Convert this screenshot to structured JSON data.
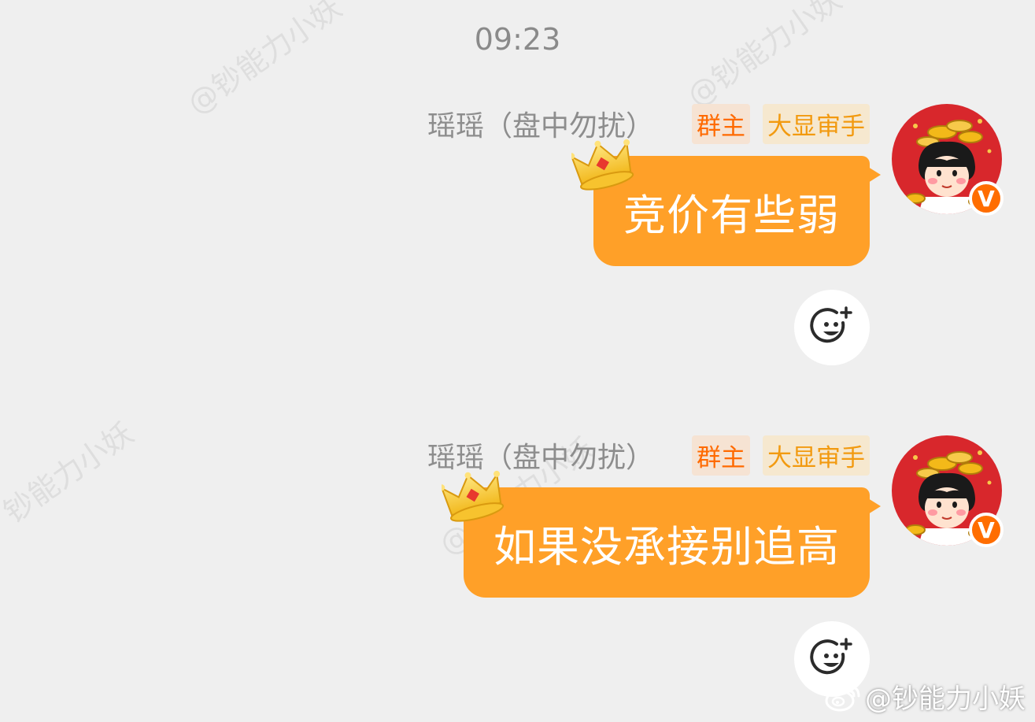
{
  "watermarks": [
    "@钞能力小妖",
    "@钞能力小妖",
    "钞能力小妖",
    "@钞能力小妖"
  ],
  "time": "09:23",
  "messages": [
    {
      "sender": "瑶瑶（盘中勿扰）",
      "badges": [
        "群主",
        "大显审手"
      ],
      "text": "竞价有些弱"
    },
    {
      "sender": "瑶瑶（盘中勿扰）",
      "badges": [
        "群主",
        "大显审手"
      ],
      "text": "如果没承接别追高"
    }
  ],
  "avatar_badge": "V",
  "footer_watermark": "@钞能力小妖",
  "colors": {
    "background": "#efefef",
    "bubble": "#ffa028",
    "owner_badge_text": "#ff6a00",
    "pro_badge_text": "#f29a10",
    "verified": "#ff6d00"
  },
  "icons": {
    "crown": "crown-icon",
    "add_reaction": "add-reaction-icon",
    "weibo": "weibo-logo-icon"
  }
}
